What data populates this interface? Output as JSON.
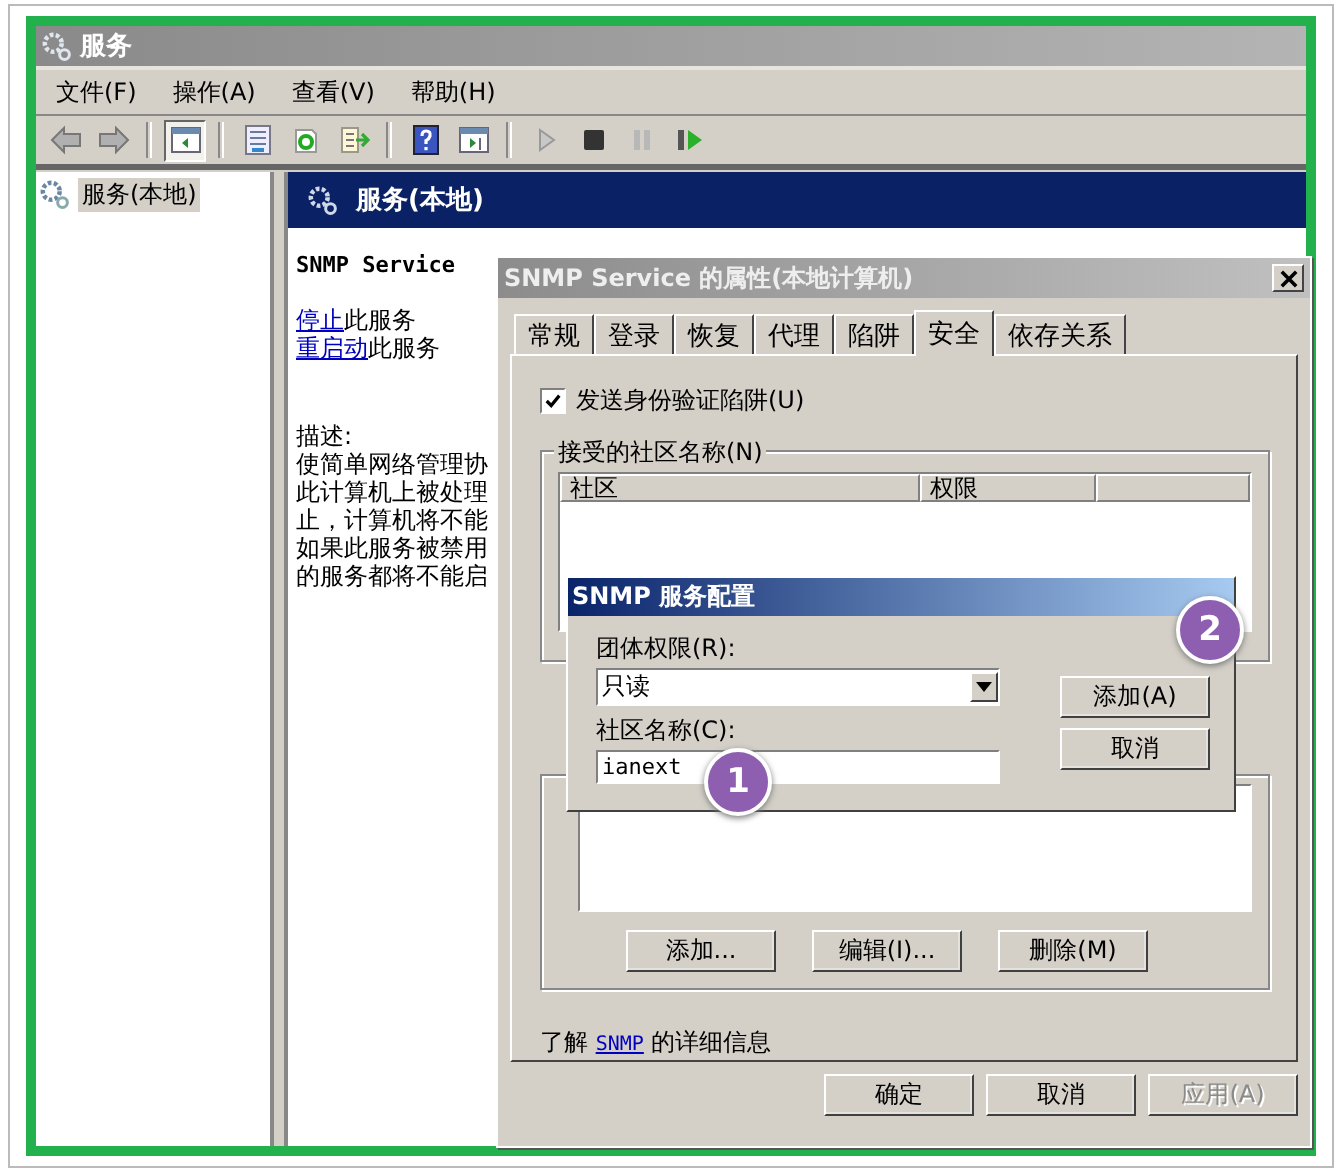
{
  "window": {
    "title": "服务"
  },
  "menu": [
    "文件(F)",
    "操作(A)",
    "查看(V)",
    "帮助(H)"
  ],
  "toolbar": [
    {
      "kind": "back"
    },
    {
      "kind": "forward"
    },
    {
      "kind": "separator"
    },
    {
      "kind": "tree",
      "pressed": true
    },
    {
      "kind": "separator"
    },
    {
      "kind": "properties",
      "pressed": false
    },
    {
      "kind": "refresh",
      "pressed": false
    },
    {
      "kind": "export",
      "pressed": false
    },
    {
      "kind": "separator"
    },
    {
      "kind": "help",
      "pressed": false
    },
    {
      "kind": "console",
      "pressed": false
    },
    {
      "kind": "separator"
    },
    {
      "kind": "play"
    },
    {
      "kind": "stop"
    },
    {
      "kind": "pause"
    },
    {
      "kind": "resume"
    }
  ],
  "tree": [
    {
      "label": "服务(本地)",
      "selected": true
    }
  ],
  "header": {
    "title": "服务(本地)"
  },
  "details": {
    "service_name": "SNMP Service",
    "actions": [
      {
        "link": "停止",
        "text": "此服务"
      },
      {
        "link": "重启动",
        "text": "此服务"
      }
    ],
    "description_label": "描述:",
    "description_lines": [
      "使简单网络管理协",
      "此计算机上被处理",
      "止，计算机将不能",
      "如果此服务被禁用",
      "的服务都将不能启"
    ]
  },
  "properties_dialog": {
    "title": "SNMP Service 的属性(本地计算机)",
    "tabs": [
      {
        "label": "常规",
        "selected": false
      },
      {
        "label": "登录",
        "selected": false
      },
      {
        "label": "恢复",
        "selected": false
      },
      {
        "label": "代理",
        "selected": false
      },
      {
        "label": "陷阱",
        "selected": false
      },
      {
        "label": "安全",
        "selected": true
      },
      {
        "label": "依存关系",
        "selected": false
      }
    ],
    "auth_trap": {
      "label": "发送身份验证陷阱(U)",
      "checked": true
    },
    "communities": {
      "label": "接受的社区名称(N)",
      "columns": [
        "社区",
        "权限"
      ]
    },
    "host_buttons": [
      "添加...",
      "编辑(I)...",
      "删除(M)"
    ],
    "info": {
      "before": "了解",
      "link": "SNMP",
      "after": "的详细信息"
    },
    "buttons": [
      {
        "label": "确定",
        "disabled": false
      },
      {
        "label": "取消",
        "disabled": false
      },
      {
        "label": "应用(A)",
        "disabled": true
      }
    ]
  },
  "config_dialog": {
    "title": "SNMP 服务配置",
    "rights_label": "团体权限(R):",
    "rights_value": "只读",
    "name_label": "社区名称(C):",
    "name_value": "ianext",
    "buttons": [
      "添加(A)",
      "取消"
    ]
  },
  "callouts": [
    "1",
    "2"
  ]
}
